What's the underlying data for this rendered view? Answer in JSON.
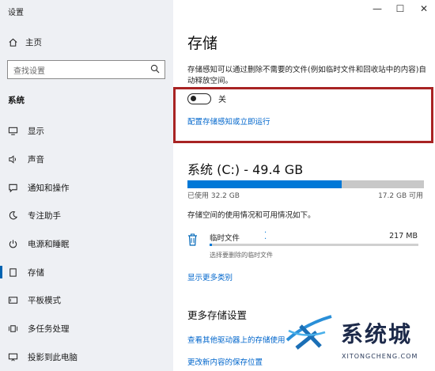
{
  "app_title": "设置",
  "window_controls": {
    "minimize": "—",
    "maximize": "☐",
    "close": "✕"
  },
  "sidebar": {
    "home_label": "主页",
    "search_placeholder": "查找设置",
    "section_label": "系统",
    "items": [
      {
        "label": "显示",
        "icon": "display-icon"
      },
      {
        "label": "声音",
        "icon": "sound-icon"
      },
      {
        "label": "通知和操作",
        "icon": "notification-icon"
      },
      {
        "label": "专注助手",
        "icon": "moon-icon"
      },
      {
        "label": "电源和睡眠",
        "icon": "power-icon"
      },
      {
        "label": "存储",
        "icon": "storage-icon",
        "active": true
      },
      {
        "label": "平板模式",
        "icon": "tablet-icon"
      },
      {
        "label": "多任务处理",
        "icon": "multitask-icon"
      },
      {
        "label": "投影到此电脑",
        "icon": "project-icon"
      }
    ]
  },
  "main": {
    "title": "存储",
    "description": "存储感知可以通过删除不需要的文件(例如临时文件和回收站中的内容)自动释放空间。",
    "toggle_state": "关",
    "config_link": "配置存储感知或立即运行",
    "drive": {
      "title": "系统 (C:) - 49.4 GB",
      "used_label": "已使用 32.2 GB",
      "free_label": "17.2 GB 可用",
      "used_fraction": 0.652
    },
    "usage_note": "存储空间的使用情况和可用情况如下。",
    "temp_files": {
      "label": "临时文件",
      "size": "217 MB",
      "sub": "选择要删除的临时文件",
      "fraction": 0.01
    },
    "show_more_link": "显示更多类别",
    "more_title": "更多存储设置",
    "other_drives_link": "查看其他驱动器上的存储使用",
    "save_location_link": "更改新内容的保存位置"
  },
  "watermark": {
    "text": "系统城",
    "sub": "XITONGCHENG.COM"
  },
  "colors": {
    "accent": "#0078d7",
    "link": "#0066cc",
    "highlight_border": "#a82323"
  }
}
